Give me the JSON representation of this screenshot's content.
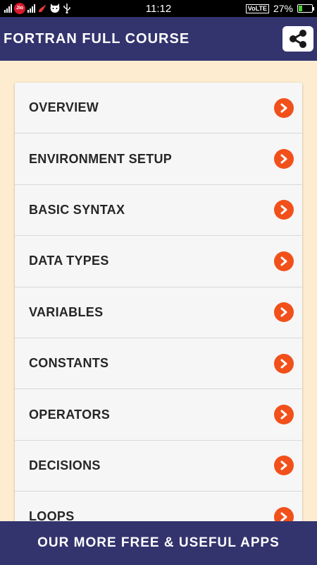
{
  "status_bar": {
    "time": "11:12",
    "network_badge": "Jio",
    "volte": "VoLTE",
    "battery": "27%",
    "battery_level": 0.27
  },
  "header": {
    "title": "FORTRAN FULL COURSE",
    "share_icon": "share-icon",
    "color": "#33336e"
  },
  "menu": {
    "items": [
      {
        "label": "OVERVIEW"
      },
      {
        "label": "ENVIRONMENT SETUP"
      },
      {
        "label": "BASIC SYNTAX"
      },
      {
        "label": "DATA TYPES"
      },
      {
        "label": "VARIABLES"
      },
      {
        "label": "CONSTANTS"
      },
      {
        "label": "OPERATORS"
      },
      {
        "label": "DECISIONS"
      },
      {
        "label": "LOOPS"
      }
    ],
    "arrow_icon": "chevron-right-icon",
    "accent_color": "#f2501a"
  },
  "banner": {
    "label": "OUR MORE FREE & USEFUL APPS"
  }
}
